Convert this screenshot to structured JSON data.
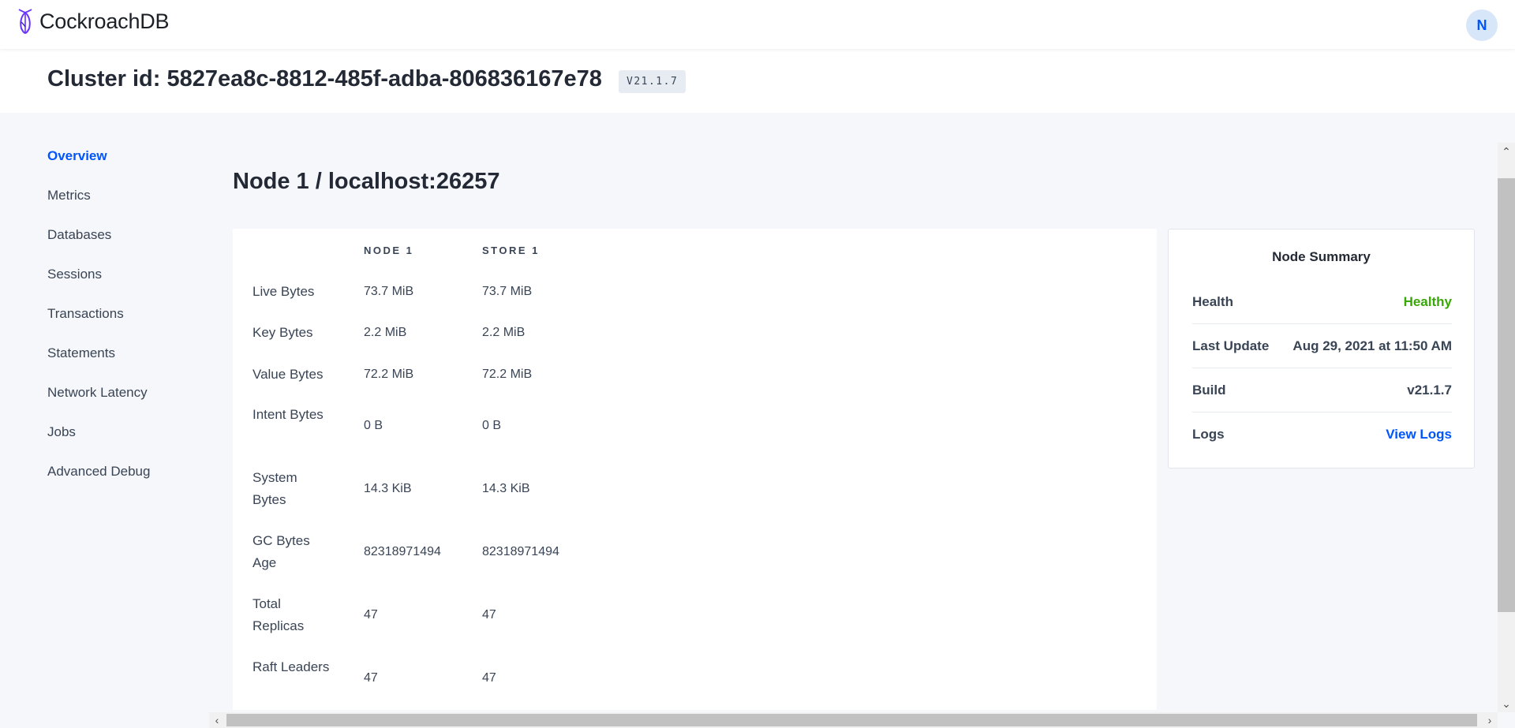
{
  "app": {
    "logo_text": "CockroachDB",
    "user_initial": "N"
  },
  "cluster": {
    "title": "Cluster id: 5827ea8c-8812-485f-adba-806836167e78",
    "version": "V21.1.7"
  },
  "sidebar": {
    "items": [
      {
        "label": "Overview",
        "active": true
      },
      {
        "label": "Metrics"
      },
      {
        "label": "Databases"
      },
      {
        "label": "Sessions"
      },
      {
        "label": "Transactions"
      },
      {
        "label": "Statements"
      },
      {
        "label": "Network Latency"
      },
      {
        "label": "Jobs"
      },
      {
        "label": "Advanced Debug"
      }
    ]
  },
  "page": {
    "title": "Node 1 / localhost:26257"
  },
  "table": {
    "headers": [
      "NODE 1",
      "STORE 1"
    ],
    "rows": [
      {
        "label": "Live Bytes",
        "node": "73.7 MiB",
        "store": "73.7 MiB"
      },
      {
        "label": "Key Bytes",
        "node": "2.2 MiB",
        "store": "2.2 MiB"
      },
      {
        "label": "Value Bytes",
        "node": "72.2 MiB",
        "store": "72.2 MiB"
      },
      {
        "label": "Intent Bytes",
        "node": "0 B",
        "store": "0 B"
      },
      {
        "label": "System Bytes",
        "node": "14.3 KiB",
        "store": "14.3 KiB"
      },
      {
        "label": "GC Bytes Age",
        "node": "82318971494",
        "store": "82318971494"
      },
      {
        "label": "Total Replicas",
        "node": "47",
        "store": "47"
      },
      {
        "label": "Raft Leaders",
        "node": "47",
        "store": "47"
      }
    ]
  },
  "summary": {
    "title": "Node Summary",
    "health_label": "Health",
    "health_value": "Healthy",
    "update_label": "Last Update",
    "update_value": "Aug 29, 2021 at 11:50 AM",
    "build_label": "Build",
    "build_value": "v21.1.7",
    "logs_label": "Logs",
    "logs_value": "View Logs"
  },
  "colors": {
    "accent": "#0055ff",
    "healthy": "#37a806",
    "text": "#394455"
  }
}
